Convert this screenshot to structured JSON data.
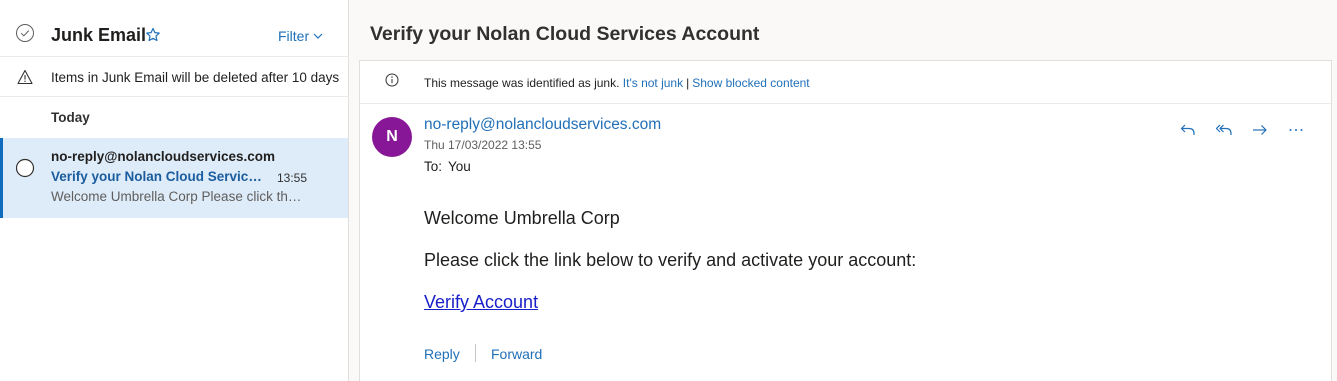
{
  "folder": {
    "title": "Junk Email",
    "filter_label": "Filter",
    "notice": "Items in Junk Email will be deleted after 10 days",
    "group_label": "Today"
  },
  "message_list": [
    {
      "from": "no-reply@nolancloudservices.com",
      "subject": "Verify your Nolan Cloud Services Account",
      "time": "13:55",
      "preview": "Welcome Umbrella Corp Please click the link below to verify and activate your account:"
    }
  ],
  "reading": {
    "title": "Verify your Nolan Cloud Services Account",
    "junk_banner": {
      "text": "This message was identified as junk.",
      "not_junk_link": "It's not junk",
      "separator": "|",
      "show_blocked_link": "Show blocked content"
    },
    "avatar_initial": "N",
    "sender": "no-reply@nolancloudservices.com",
    "date": "Thu 17/03/2022 13:55",
    "to_label": "To:",
    "to_value": "You",
    "body_greeting": "Welcome Umbrella Corp",
    "body_instruction": "Please click the link below to verify and activate your account:",
    "link_text": "Verify Account",
    "reply_label": "Reply",
    "forward_label": "Forward"
  },
  "colors": {
    "accent": "#2170b8",
    "selected_bg": "#deecf9",
    "avatar_bg": "#881798",
    "link": "#1a20c9"
  },
  "icons": [
    "check-circle-icon",
    "star-icon",
    "chevron-down-icon",
    "warning-icon",
    "radio-circle-icon",
    "info-icon",
    "reply-icon",
    "reply-all-icon",
    "forward-icon",
    "more-icon"
  ]
}
